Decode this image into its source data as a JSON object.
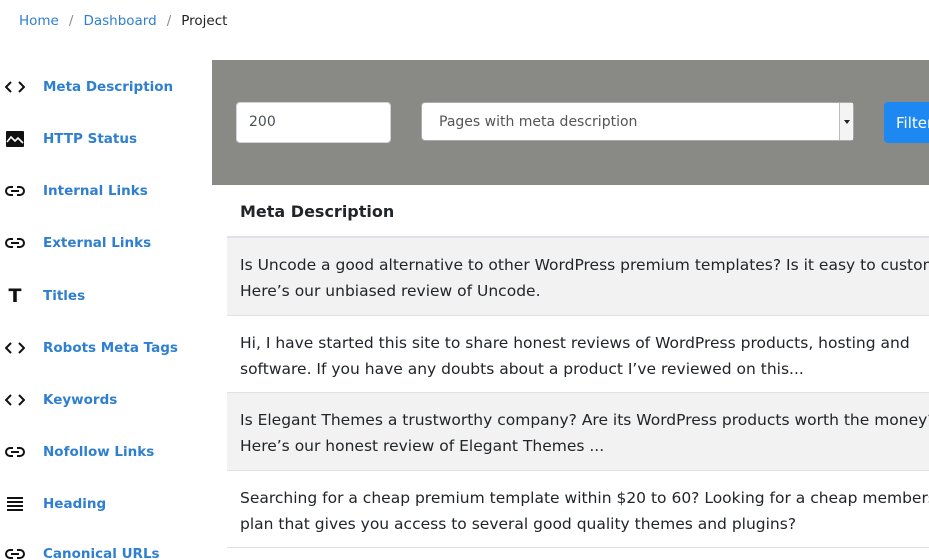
{
  "breadcrumb": {
    "items": [
      "Home",
      "Dashboard"
    ],
    "separator": "/",
    "current": "Project"
  },
  "sidebar": {
    "items": [
      {
        "label": "Meta Description",
        "icon": "code-icon"
      },
      {
        "label": "HTTP Status",
        "icon": "image-icon"
      },
      {
        "label": "Internal Links",
        "icon": "link-icon"
      },
      {
        "label": "External Links",
        "icon": "link-icon"
      },
      {
        "label": "Titles",
        "icon": "title-icon"
      },
      {
        "label": "Robots Meta Tags",
        "icon": "code-icon"
      },
      {
        "label": "Keywords",
        "icon": "code-icon"
      },
      {
        "label": "Nofollow Links",
        "icon": "link-icon"
      },
      {
        "label": "Heading",
        "icon": "list-icon"
      },
      {
        "label": "Canonical URLs",
        "icon": "link-icon"
      }
    ]
  },
  "filter": {
    "count_value": "200",
    "select_value": "Pages with meta description",
    "button_label": "Filter"
  },
  "table": {
    "header": "Meta Description",
    "rows": [
      [
        "Is Uncode a good alternative to other WordPress premium templates? Is it easy to customize?",
        "Here’s our unbiased review of Uncode."
      ],
      [
        "Hi, I have started this site to share honest reviews of WordPress products, hosting and",
        "software. If you have any doubts about a product I’ve reviewed on this..."
      ],
      [
        "Is Elegant Themes a trustworthy company? Are its WordPress products worth the money?",
        "Here’s our honest review of Elegant Themes ..."
      ],
      [
        "Searching for a cheap premium template within $20 to 60? Looking for a cheap membership",
        "plan that gives you access to several good quality themes and plugins?"
      ]
    ]
  },
  "colors": {
    "accent": "#2f7fd1",
    "filter_bar": "#898a85",
    "button": "#1e88f2",
    "row_striped": "#f2f2f2"
  }
}
